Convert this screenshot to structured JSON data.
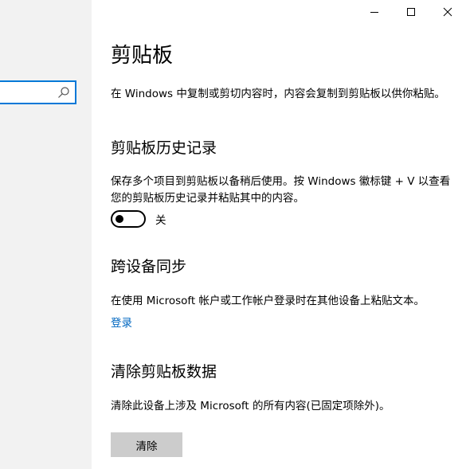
{
  "window": {
    "minimize_icon": "minimize-icon",
    "maximize_icon": "maximize-icon",
    "close_icon": "close-icon"
  },
  "sidebar": {
    "search_placeholder": "",
    "search_icon": "search-icon"
  },
  "page": {
    "title": "剪贴板",
    "intro": "在 Windows 中复制或剪切内容时，内容会复制到剪贴板以供你粘贴。"
  },
  "history": {
    "title": "剪贴板历史记录",
    "description": "保存多个项目到剪贴板以备稍后使用。按 Windows 徽标键 + V 以查看您的剪贴板历史记录并粘贴其中的内容。",
    "toggle_state": "关",
    "toggle_on": false
  },
  "sync": {
    "title": "跨设备同步",
    "description": "在使用 Microsoft 帐户或工作帐户登录时在其他设备上粘贴文本。",
    "signin_link": "登录"
  },
  "clear": {
    "title": "清除剪贴板数据",
    "description": "清除此设备上涉及 Microsoft 的所有内容(已固定项除外)。",
    "button_label": "清除"
  },
  "colors": {
    "accent": "#0078d7",
    "link": "#0067c0",
    "sidebar_bg": "#f2f2f2",
    "button_bg": "#cccccc"
  }
}
